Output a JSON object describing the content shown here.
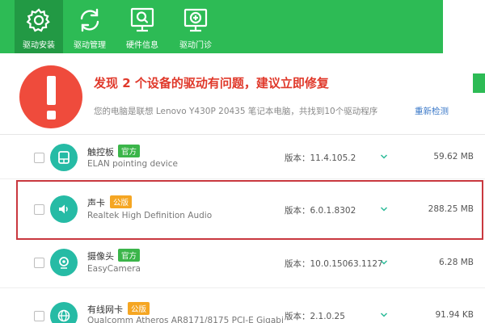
{
  "toolbar": {
    "items": [
      {
        "label": "驱动安装",
        "icon": "gear-icon",
        "active": true
      },
      {
        "label": "驱动管理",
        "icon": "refresh-icon",
        "active": false
      },
      {
        "label": "硬件信息",
        "icon": "monitor-search-icon",
        "active": false
      },
      {
        "label": "驱动门诊",
        "icon": "medical-cross-icon",
        "active": false
      }
    ],
    "bg_color": "#2dbb55",
    "active_color": "#229944"
  },
  "alert": {
    "title": "发现 2 个设备的驱动有问题，建议立即修复",
    "subtitle": "您的电脑是联想 Lenovo Y430P 20435 笔记本电脑，共找到10个驱动程序",
    "rescan_link": "重新检测",
    "accent_color": "#ef4b3c"
  },
  "drivers": [
    {
      "name": "触控板",
      "badge": "官方",
      "badge_type": "official",
      "model": "ELAN pointing device",
      "version": "版本：11.4.105.2",
      "size": "59.62 MB",
      "icon": "touchpad-icon",
      "highlighted": false
    },
    {
      "name": "声卡",
      "badge": "公版",
      "badge_type": "public",
      "model": "Realtek High Definition Audio",
      "version": "版本：6.0.1.8302",
      "size": "288.25 MB",
      "icon": "speaker-icon",
      "highlighted": true
    },
    {
      "name": "摄像头",
      "badge": "官方",
      "badge_type": "official",
      "model": "EasyCamera",
      "version": "版本：10.0.15063.1127",
      "size": "6.28 MB",
      "icon": "camera-icon",
      "highlighted": false
    },
    {
      "name": "有线网卡",
      "badge": "公版",
      "badge_type": "public",
      "model": "Qualcomm Atheros AR8171/8175 PCI-E Gigabi",
      "version": "版本：2.1.0.25",
      "size": "91.94 KB",
      "icon": "globe-icon",
      "highlighted": false
    }
  ]
}
